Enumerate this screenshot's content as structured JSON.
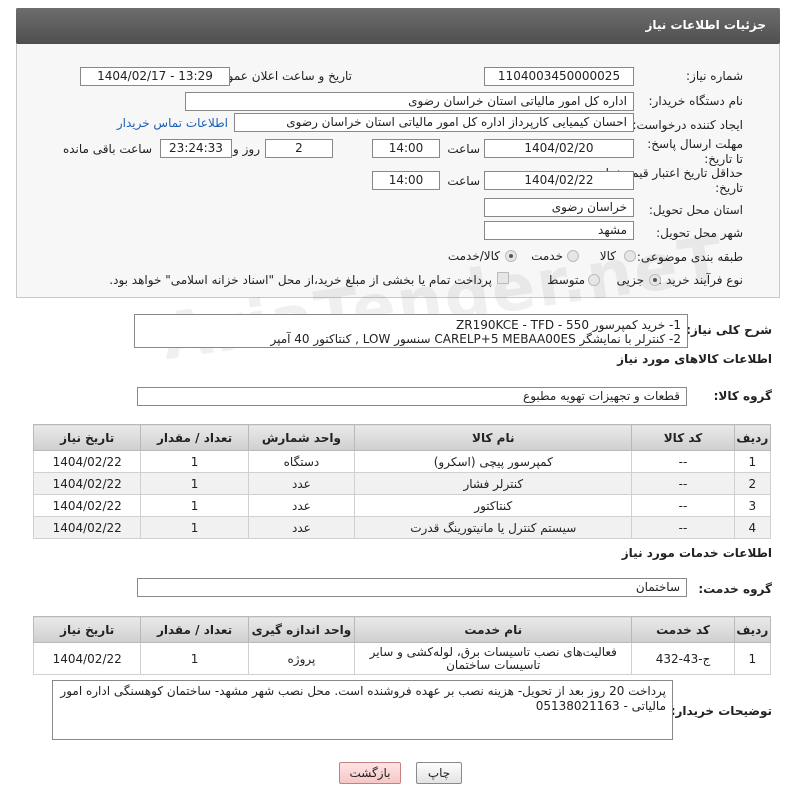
{
  "header": {
    "title": "جزئیات اطلاعات نیاز"
  },
  "form": {
    "need_number": {
      "label": "شماره نیاز:",
      "value": "1104003450000025"
    },
    "announce": {
      "label": "تاریخ و ساعت اعلان عمومی:",
      "value": "1404/02/17 - 13:29"
    },
    "buyer_org": {
      "label": "نام دستگاه خریدار:",
      "value": "اداره کل امور مالیاتی استان خراسان رضوی"
    },
    "requester": {
      "label": "ایجاد کننده درخواست:",
      "value": "احسان کیمیایی کارپرداز اداره کل امور مالیاتی استان خراسان رضوی",
      "contact_link": "اطلاعات تماس خریدار"
    },
    "deadline": {
      "label": "مهلت ارسال پاسخ: تا تاریخ:",
      "date": "1404/02/20",
      "time_label": "ساعت",
      "time": "14:00",
      "days": "2",
      "days_label": "روز و",
      "remaining": "23:24:33",
      "remaining_label": "ساعت باقی مانده"
    },
    "validity": {
      "label": "حداقل تاریخ اعتبار قیمت: تا تاریخ:",
      "date": "1404/02/22",
      "time_label": "ساعت",
      "time": "14:00"
    },
    "province": {
      "label": "استان محل تحویل:",
      "value": "خراسان رضوی"
    },
    "city": {
      "label": "شهر محل تحویل:",
      "value": "مشهد"
    },
    "category": {
      "label": "طبقه بندی موضوعی:",
      "options": [
        "کالا",
        "خدمت",
        "کالا/خدمت"
      ]
    },
    "process": {
      "label": "نوع فرآیند خرید :",
      "options": [
        "جزیی",
        "متوسط"
      ],
      "note": "پرداخت تمام یا بخشی از مبلغ خرید،از محل \"اسناد خزانه اسلامی\" خواهد بود."
    }
  },
  "summary": {
    "label": "شرح کلی نیاز:",
    "line1": "1- خرید کمپرسور ZR190KCE - TFD - 550",
    "line2": "2- کنترلر با نمایشگر CARELP+5 MEBAA00ES  سنسور LOW  , کنتاکتور 40 آمپر"
  },
  "goods": {
    "section_title": "اطلاعات کالاهای مورد نیاز",
    "group_label": "گروه کالا:",
    "group_value": "قطعات و تجهیزات تهویه مطبوع",
    "headers": [
      "ردیف",
      "کد کالا",
      "نام کالا",
      "واحد شمارش",
      "تعداد / مقدار",
      "تاریخ نیاز"
    ],
    "rows": [
      [
        "1",
        "--",
        "کمپرسور پیچی (اسکرو)",
        "دستگاه",
        "1",
        "1404/02/22"
      ],
      [
        "2",
        "--",
        "کنترلر فشار",
        "عدد",
        "1",
        "1404/02/22"
      ],
      [
        "3",
        "--",
        "کنتاکتور",
        "عدد",
        "1",
        "1404/02/22"
      ],
      [
        "4",
        "--",
        "سیستم کنترل یا مانیتورینگ قدرت",
        "عدد",
        "1",
        "1404/02/22"
      ]
    ]
  },
  "services": {
    "section_title": "اطلاعات خدمات مورد نیاز",
    "group_label": "گروه خدمت:",
    "group_value": "ساختمان",
    "headers": [
      "ردیف",
      "کد خدمت",
      "نام خدمت",
      "واحد اندازه گیری",
      "تعداد / مقدار",
      "تاریخ نیاز"
    ],
    "rows": [
      [
        "1",
        "ج-43-432",
        "فعالیت‌های نصب تاسیسات برق، لوله‌کشی و سایر تاسیسات ساختمان",
        "پروژه",
        "1",
        "1404/02/22"
      ]
    ]
  },
  "buyer_notes": {
    "label": "توضیحات خریدار:",
    "text": "پرداخت 20 روز بعد از تحویل- هزینه نصب بر عهده فروشنده است. محل نصب شهر مشهد- ساختمان کوهسنگی اداره امور مالیاتی - 05138021163"
  },
  "buttons": {
    "print": "چاپ",
    "back": "بازگشت"
  },
  "watermark": "AriaTender.neT"
}
